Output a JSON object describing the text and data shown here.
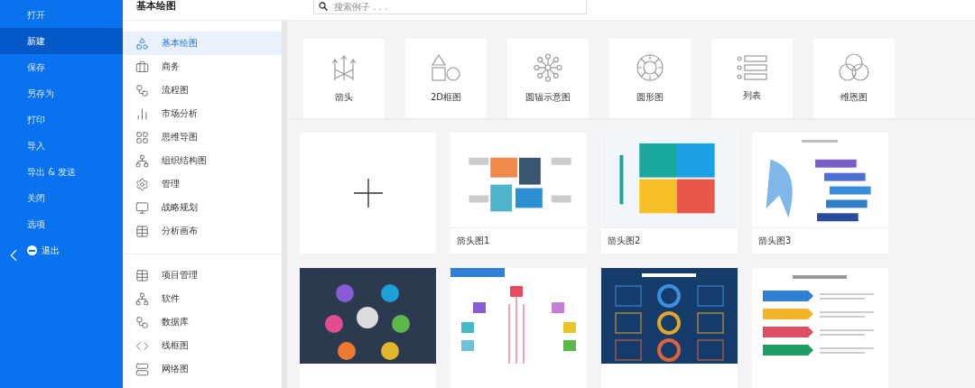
{
  "menu": [
    {
      "label": "打开",
      "selected": false
    },
    {
      "label": "新建",
      "selected": true
    },
    {
      "label": "保存",
      "selected": false
    },
    {
      "label": "另存为",
      "selected": false
    },
    {
      "label": "打印",
      "selected": false
    },
    {
      "label": "导入",
      "selected": false
    },
    {
      "label": "导出 & 发送",
      "selected": false
    },
    {
      "label": "关闭",
      "selected": false
    },
    {
      "label": "选项",
      "selected": false
    }
  ],
  "exit": {
    "label": "退出"
  },
  "panel": {
    "title": "基本绘图",
    "search": {
      "placeholder": "搜索例子 . . ."
    }
  },
  "category_groups": [
    [
      {
        "label": "基本绘图",
        "selected": true
      },
      {
        "label": "商务",
        "selected": false
      },
      {
        "label": "流程图",
        "selected": false
      },
      {
        "label": "市场分析",
        "selected": false
      },
      {
        "label": "思维导图",
        "selected": false
      },
      {
        "label": "组织结构图",
        "selected": false
      },
      {
        "label": "管理",
        "selected": false
      },
      {
        "label": "战略规划",
        "selected": false
      },
      {
        "label": "分析画布",
        "selected": false
      }
    ],
    [
      {
        "label": "项目管理",
        "selected": false
      },
      {
        "label": "软件",
        "selected": false
      },
      {
        "label": "数据库",
        "selected": false
      },
      {
        "label": "线框图",
        "selected": false
      },
      {
        "label": "网络图",
        "selected": false
      }
    ]
  ],
  "shape_types": [
    {
      "label": "箭头"
    },
    {
      "label": "2D框图"
    },
    {
      "label": "圆辐示意图"
    },
    {
      "label": "圆形图"
    },
    {
      "label": "列表"
    },
    {
      "label": "维恩图"
    }
  ],
  "templates": [
    {
      "kind": "blank"
    },
    {
      "kind": "template",
      "label": "箭头图1"
    },
    {
      "kind": "template",
      "label": "箭头图2"
    },
    {
      "kind": "template",
      "label": "箭头图3"
    },
    {
      "kind": "template"
    },
    {
      "kind": "template"
    },
    {
      "kind": "template"
    },
    {
      "kind": "template"
    }
  ]
}
